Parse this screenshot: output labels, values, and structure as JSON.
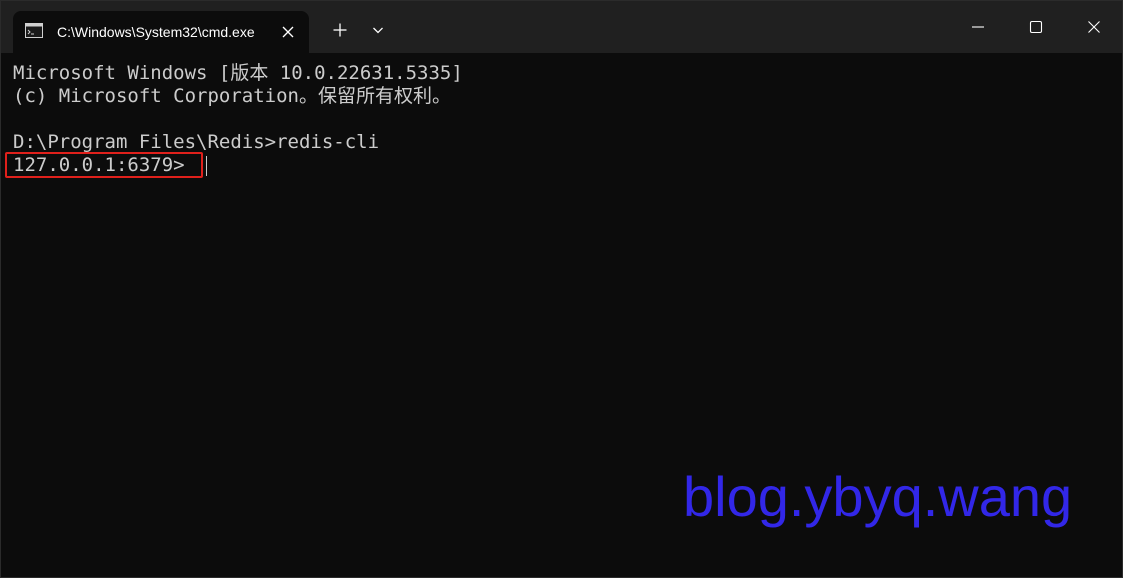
{
  "window": {
    "tab_title": "C:\\Windows\\System32\\cmd.exe",
    "new_tab_icon": "plus-icon",
    "dropdown_icon": "chevron-down-icon",
    "minimize_icon": "minimize-icon",
    "maximize_icon": "maximize-icon",
    "close_icon": "close-icon"
  },
  "terminal": {
    "lines": [
      "Microsoft Windows [版本 10.0.22631.5335]",
      "(c) Microsoft Corporation。保留所有权利。",
      "",
      "D:\\Program Files\\Redis>redis-cli",
      "127.0.0.1:6379>"
    ]
  },
  "watermark": "blog.ybyq.wang",
  "colors": {
    "terminal_bg": "#0c0c0c",
    "titlebar_bg": "#202020",
    "text": "#cccccc",
    "highlight_box": "#e0201b",
    "watermark": "#3227e8"
  }
}
